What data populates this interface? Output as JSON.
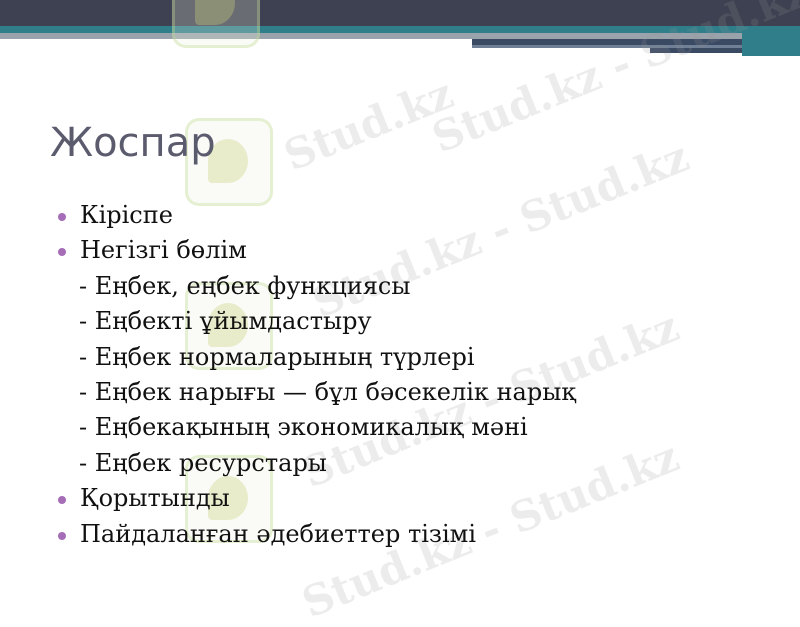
{
  "slide": {
    "title": "Жоспар",
    "items": [
      {
        "type": "bullet",
        "text": "Кіріспе"
      },
      {
        "type": "bullet",
        "text": "Негізгі бөлім"
      },
      {
        "type": "sub",
        "text": "- Еңбек, еңбек функциясы"
      },
      {
        "type": "sub",
        "text": "- Еңбекті ұйымдастыру"
      },
      {
        "type": "sub",
        "text": "- Еңбек нормаларының түрлері"
      },
      {
        "type": "sub",
        "text": "- Еңбек нарығы — бұл бәсекелік нарық"
      },
      {
        "type": "sub",
        "text": "- Еңбекақының экономикалық мәні"
      },
      {
        "type": "sub",
        "text": "- Еңбек ресурстары"
      },
      {
        "type": "bullet",
        "text": "Қорытынды"
      },
      {
        "type": "bullet",
        "text": "Пайдаланған әдебиеттер тізімі"
      }
    ]
  },
  "watermark": {
    "text": "Stud.kz",
    "text_long": "Stud.kz - Stud.kz"
  },
  "colors": {
    "header_dark": "#3e4151",
    "header_teal": "#2f7e8a",
    "title": "#5b5b6e",
    "bullet": "#a46db6",
    "body_text": "#111111"
  }
}
